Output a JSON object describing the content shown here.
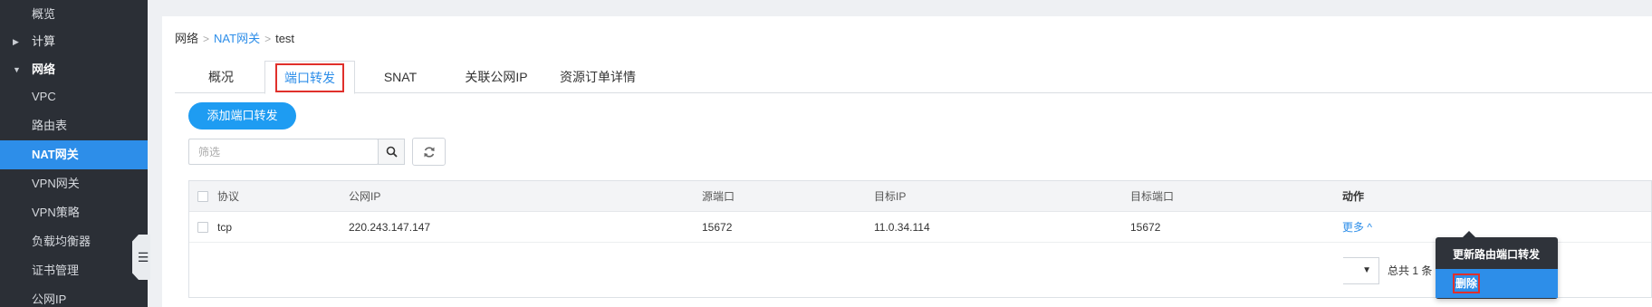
{
  "sidebar": {
    "items": [
      {
        "label": "概览",
        "type": "item"
      },
      {
        "label": "计算",
        "type": "group-collapsed"
      },
      {
        "label": "网络",
        "type": "group-open"
      },
      {
        "label": "VPC",
        "type": "item"
      },
      {
        "label": "路由表",
        "type": "item"
      },
      {
        "label": "NAT网关",
        "type": "active"
      },
      {
        "label": "VPN网关",
        "type": "item"
      },
      {
        "label": "VPN策略",
        "type": "item"
      },
      {
        "label": "负载均衡器",
        "type": "item"
      },
      {
        "label": "证书管理",
        "type": "item"
      },
      {
        "label": "公网IP",
        "type": "item"
      }
    ],
    "collapse_icon": "indent-icon"
  },
  "breadcrumb": {
    "root": "网络",
    "parent": "NAT网关",
    "current": "test",
    "separator": ">"
  },
  "tabs": [
    {
      "label": "概况"
    },
    {
      "label": "端口转发",
      "active": true
    },
    {
      "label": "SNAT"
    },
    {
      "label": "关联公网IP"
    },
    {
      "label": "资源订单详情"
    }
  ],
  "toolbar": {
    "add_label": "添加端口转发",
    "search_placeholder": "筛选",
    "search_icon": "search-icon",
    "refresh_icon": "refresh-icon"
  },
  "table": {
    "columns": [
      "协议",
      "公网IP",
      "源端口",
      "目标IP",
      "目标端口",
      "动作"
    ],
    "rows": [
      {
        "protocol": "tcp",
        "public_ip": "220.243.147.147",
        "source_port": "15672",
        "target_ip": "11.0.34.114",
        "target_port": "15672",
        "action": "更多 ^"
      }
    ]
  },
  "pagination": {
    "total": "总共 1 条"
  },
  "action_menu": {
    "items": [
      {
        "label": "更新路由端口转发"
      },
      {
        "label": "删除",
        "selected": true
      }
    ]
  },
  "colors": {
    "accent": "#2d8ee9",
    "sidebar_bg": "#2b2f36",
    "highlight_box": "#e0302b"
  }
}
